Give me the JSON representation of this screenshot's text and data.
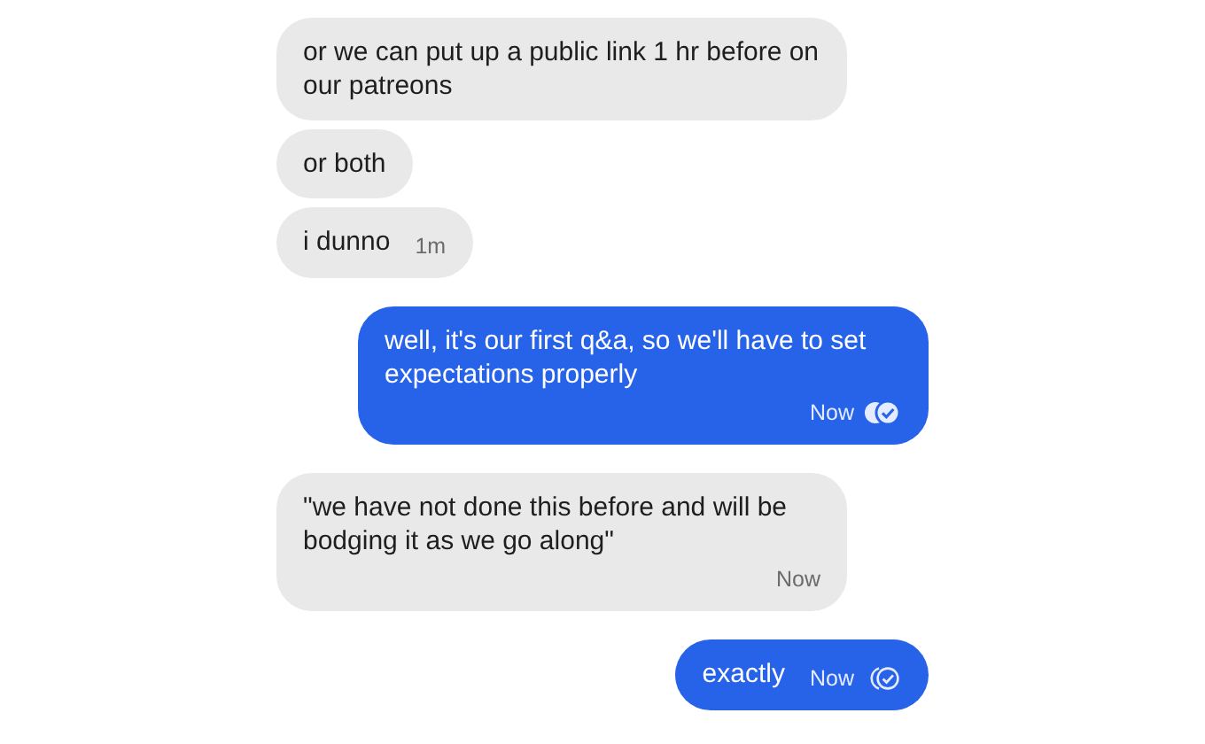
{
  "messages": [
    {
      "kind": "incoming",
      "text": "or we can put up a public link 1 hr before on our patreons"
    },
    {
      "kind": "incoming",
      "text": "or both"
    },
    {
      "kind": "incoming",
      "text": "i dunno",
      "time": "1m"
    },
    {
      "kind": "outgoing",
      "text": "well, it's our first q&a, so we'll have to set expectations properly",
      "time": "Now",
      "read": true
    },
    {
      "kind": "incoming",
      "text": "\"we have not done this before and will be bodging it as we go along\"",
      "time": "Now"
    },
    {
      "kind": "outgoing",
      "text": "exactly",
      "time": "Now",
      "read": false
    }
  ]
}
